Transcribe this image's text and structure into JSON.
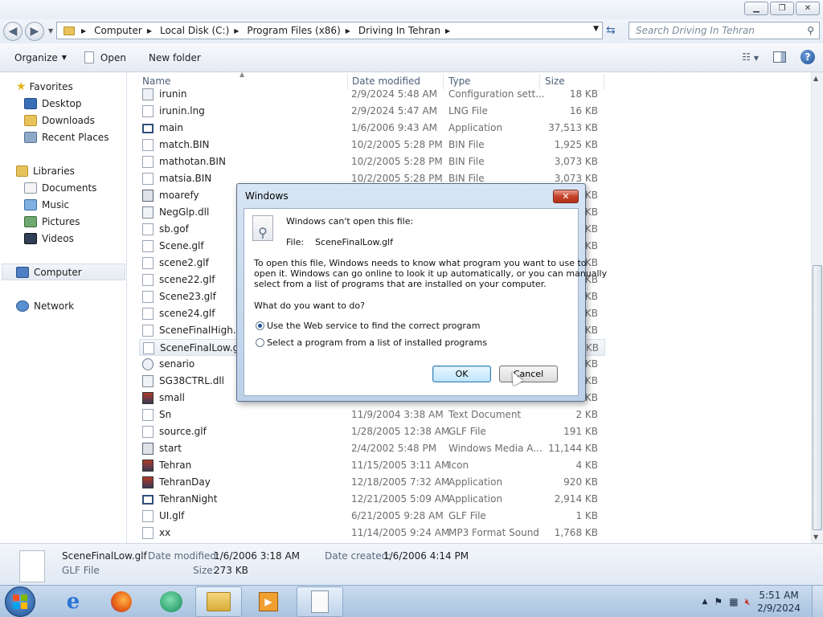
{
  "window": {
    "title_buttons": [
      "minimize",
      "maximize",
      "close"
    ]
  },
  "address": {
    "breadcrumbs": [
      "Computer",
      "Local Disk (C:)",
      "Program Files (x86)",
      "Driving In Tehran"
    ],
    "search_placeholder": "Search Driving In Tehran"
  },
  "toolbar": {
    "organize": "Organize",
    "open": "Open",
    "new_folder": "New folder"
  },
  "nav": {
    "favorites": "Favorites",
    "desktop": "Desktop",
    "downloads": "Downloads",
    "recent_places": "Recent Places",
    "libraries": "Libraries",
    "documents": "Documents",
    "music": "Music",
    "pictures": "Pictures",
    "videos": "Videos",
    "computer": "Computer",
    "network": "Network"
  },
  "columns": {
    "name": "Name",
    "date_modified": "Date modified",
    "type": "Type",
    "size": "Size"
  },
  "files": [
    {
      "name": "irunin",
      "date": "2/9/2024 5:48 AM",
      "type": "Configuration sett...",
      "size": "18 KB",
      "icon": "config-file-icon"
    },
    {
      "name": "irunin.lng",
      "date": "2/9/2024 5:47 AM",
      "type": "LNG File",
      "size": "16 KB",
      "icon": "file-icon"
    },
    {
      "name": "main",
      "date": "1/6/2006 9:43 AM",
      "type": "Application",
      "size": "37,513 KB",
      "icon": "application-icon"
    },
    {
      "name": "match.BIN",
      "date": "10/2/2005 5:28 PM",
      "type": "BIN File",
      "size": "1,925 KB",
      "icon": "file-icon"
    },
    {
      "name": "mathotan.BIN",
      "date": "10/2/2005 5:28 PM",
      "type": "BIN File",
      "size": "3,073 KB",
      "icon": "file-icon"
    },
    {
      "name": "matsia.BIN",
      "date": "10/2/2005 5:28 PM",
      "type": "BIN File",
      "size": "3,073 KB",
      "icon": "file-icon"
    },
    {
      "name": "moarefy",
      "date": "",
      "type": "",
      "size": "KB",
      "icon": "media-file-icon"
    },
    {
      "name": "NegGlp.dll",
      "date": "",
      "type": "",
      "size": "KB",
      "icon": "dll-icon"
    },
    {
      "name": "sb.gof",
      "date": "",
      "type": "",
      "size": "KB",
      "icon": "file-icon"
    },
    {
      "name": "Scene.glf",
      "date": "",
      "type": "",
      "size": "KB",
      "icon": "file-icon"
    },
    {
      "name": "scene2.glf",
      "date": "",
      "type": "",
      "size": "KB",
      "icon": "file-icon"
    },
    {
      "name": "scene22.glf",
      "date": "",
      "type": "",
      "size": "KB",
      "icon": "file-icon"
    },
    {
      "name": "Scene23.glf",
      "date": "",
      "type": "",
      "size": "KB",
      "icon": "file-icon"
    },
    {
      "name": "scene24.glf",
      "date": "",
      "type": "",
      "size": "KB",
      "icon": "file-icon"
    },
    {
      "name": "SceneFinalHigh.gl",
      "date": "",
      "type": "",
      "size": "KB",
      "icon": "file-icon"
    },
    {
      "name": "SceneFinalLow.glf",
      "date": "",
      "type": "",
      "size": "KB",
      "icon": "file-icon"
    },
    {
      "name": "senario",
      "date": "",
      "type": "",
      "size": "KB",
      "icon": "flash-file-icon"
    },
    {
      "name": "SG38CTRL.dll",
      "date": "",
      "type": "",
      "size": "KB",
      "icon": "dll-icon"
    },
    {
      "name": "small",
      "date": "",
      "type": "",
      "size": "KB",
      "icon": "image-app-icon"
    },
    {
      "name": "Sn",
      "date": "11/9/2004 3:38 AM",
      "type": "Text Document",
      "size": "2 KB",
      "icon": "text-file-icon"
    },
    {
      "name": "source.glf",
      "date": "1/28/2005 12:38 AM",
      "type": "GLF File",
      "size": "191 KB",
      "icon": "file-icon"
    },
    {
      "name": "start",
      "date": "2/4/2002 5:48 PM",
      "type": "Windows Media A...",
      "size": "11,144 KB",
      "icon": "media-file-icon"
    },
    {
      "name": "Tehran",
      "date": "11/15/2005 3:11 AM",
      "type": "Icon",
      "size": "4 KB",
      "icon": "image-app-icon"
    },
    {
      "name": "TehranDay",
      "date": "12/18/2005 7:32 AM",
      "type": "Application",
      "size": "920 KB",
      "icon": "image-app-icon"
    },
    {
      "name": "TehranNight",
      "date": "12/21/2005 5:09 AM",
      "type": "Application",
      "size": "2,914 KB",
      "icon": "application-icon"
    },
    {
      "name": "UI.glf",
      "date": "6/21/2005 9:28 AM",
      "type": "GLF File",
      "size": "1 KB",
      "icon": "file-icon"
    },
    {
      "name": "xx",
      "date": "11/14/2005 9:24 AM",
      "type": "MP3 Format Sound",
      "size": "1,768 KB",
      "icon": "audio-file-icon"
    }
  ],
  "selected_file_name": "SceneFinalLow.glf",
  "details": {
    "name": "SceneFinalLow.glf",
    "type": "GLF File",
    "date_modified_label": "Date modified:",
    "date_modified": "1/6/2006 3:18 AM",
    "date_created_label": "Date created:",
    "date_created": "1/6/2006 4:14 PM",
    "size_label": "Size:",
    "size": "273 KB"
  },
  "dialog": {
    "title": "Windows",
    "heading": "Windows can't open this file:",
    "file_label": "File:",
    "file_name": "SceneFinalLow.glf",
    "explanation_line1": "To open this file, Windows needs to know what program you want to use to",
    "explanation_line2": "open it. Windows can go online to look it up automatically, or you can manually",
    "explanation_line3": "select from a list of programs that are installed on your computer.",
    "question": "What do you want to do?",
    "option_web": "Use the Web service to find the correct program",
    "option_list": "Select a program from a list of installed programs",
    "selected_option": "web",
    "ok": "OK",
    "cancel": "Cancel"
  },
  "taskbar": {
    "time": "5:51 AM",
    "date": "2/9/2024",
    "pinned": [
      "internet-explorer-icon",
      "firefox-icon",
      "media-center-icon",
      "explorer-folder-icon",
      "media-player-icon",
      "document-window-icon"
    ]
  }
}
